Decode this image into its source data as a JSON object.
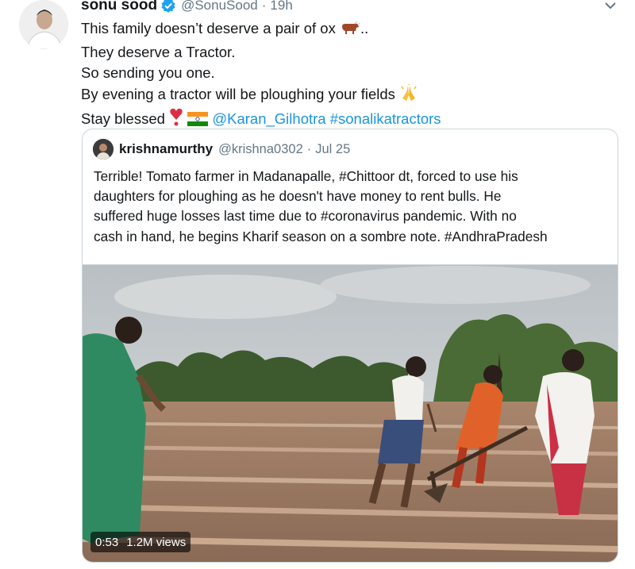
{
  "tweet": {
    "author_name": "sonu sood",
    "handle": "@SonuSood",
    "separator": "·",
    "time": "19h",
    "lines": [
      "This family doesn’t deserve a pair of ox",
      "..",
      "They deserve a Tractor.",
      "So sending you one.",
      "By evening a tractor will be ploughing your fields",
      "Stay blessed",
      "@Karan_Gilhotra",
      "#sonalikatractors"
    ]
  },
  "quote": {
    "author_name": "krishnamurthy",
    "handle": "@krishna0302",
    "separator": "·",
    "time": "Jul 25",
    "lines": [
      "Terrible! Tomato farmer in Madanapalle, #Chittoor dt, forced to use his",
      "daughters for ploughing as he doesn't have money to rent bulls. He",
      "suffered huge losses last time due to #coronavirus pandemic. With no",
      "cash in hand, he begins Kharif season on a sombre note. #AndhraPradesh"
    ],
    "video": {
      "duration": "0:53",
      "views": "1.2M views"
    }
  },
  "icons": {
    "verified": "verified-badge-icon",
    "more": "chevron-down-icon",
    "ox": "ox-emoji-icon",
    "pray": "folded-hands-emoji-icon",
    "heart": "heart-exclamation-emoji-icon",
    "flag": "india-flag-emoji-icon"
  },
  "colors": {
    "link": "#1b95e0",
    "secondary": "#657786",
    "verified": "#1da1f2",
    "border": "#ccd6dd"
  }
}
